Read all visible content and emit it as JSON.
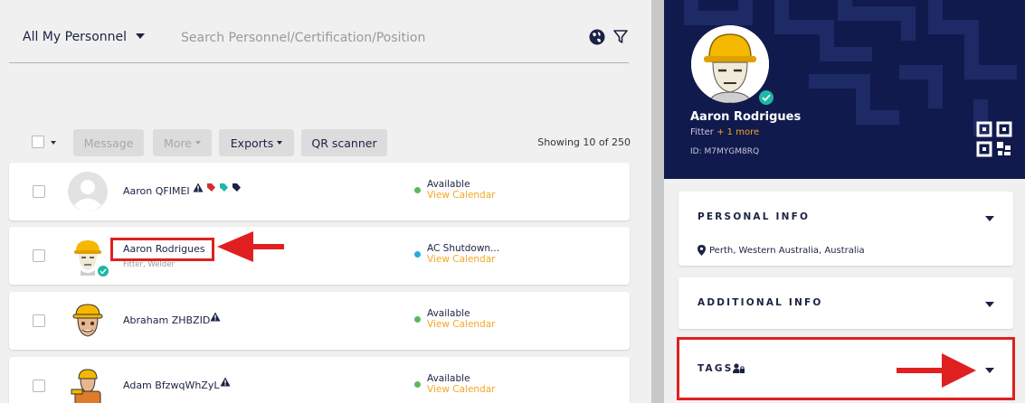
{
  "list": {
    "scope_label": "All My Personnel",
    "search_placeholder": "Search Personnel/Certification/Position",
    "buttons": {
      "message": "Message",
      "more": "More",
      "exports": "Exports",
      "qr_scanner": "QR scanner"
    },
    "showing": "Showing 10 of 250",
    "rows": [
      {
        "name": "Aaron QFIMEI",
        "subtitle": "",
        "status": "Available",
        "calendar": "View Calendar",
        "status_color": "#5cb85c"
      },
      {
        "name": "Aaron Rodrigues",
        "subtitle": "Fitter, Welder",
        "status": "AC Shutdown...",
        "calendar": "View Calendar",
        "status_color": "#29a8e0"
      },
      {
        "name": "Abraham ZHBZID",
        "subtitle": "",
        "status": "Available",
        "calendar": "View Calendar",
        "status_color": "#5cb85c"
      },
      {
        "name": "Adam BfzwqWhZyL",
        "subtitle": "",
        "status": "Available",
        "calendar": "View Calendar",
        "status_color": "#5cb85c"
      }
    ]
  },
  "profile": {
    "name": "Aaron Rodrigues",
    "role": "Fitter",
    "more_roles": "+ 1 more",
    "id": "ID: M7MYGM8RQ",
    "sections": {
      "personal": "PERSONAL INFO",
      "location": "Perth, Western Australia, Australia",
      "additional": "ADDITIONAL INFO",
      "tags": "TAGS"
    }
  },
  "colors": {
    "navy": "#111a4d",
    "accent_orange": "#f5a623",
    "annotation_red": "#e02020",
    "verified_teal": "#1fb8a5"
  }
}
